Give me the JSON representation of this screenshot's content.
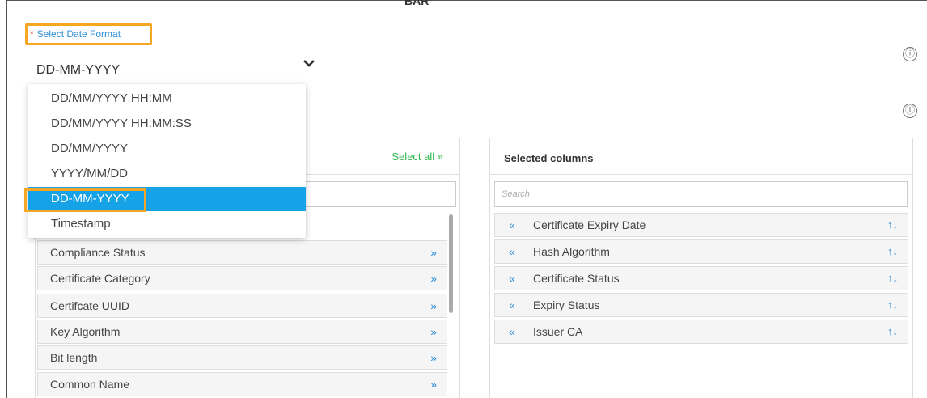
{
  "header": {
    "cut_title": "BAR"
  },
  "date_format": {
    "label": "Select Date Format",
    "required_mark": "*",
    "selected_value": "DD-MM-YYYY",
    "options": [
      "DD/MM/YYYY HH:MM",
      "DD/MM/YYYY HH:MM:SS",
      "DD/MM/YYYY",
      "YYYY/MM/DD",
      "DD-MM-YYYY",
      "Timestamp"
    ],
    "highlighted_option": "DD-MM-YYYY"
  },
  "icons": {
    "info": "ⓘ",
    "chevron": "chevron-down-icon",
    "move_right": "»",
    "move_left": "«",
    "sort": "↑↓"
  },
  "available_columns": {
    "select_all_label": "Select all »",
    "rows": [
      "Compliance Status",
      "Certificate Category",
      "Certifcate UUID",
      "Key Algorithm",
      "Bit length",
      "Common Name"
    ]
  },
  "selected_columns": {
    "title": "Selected columns",
    "search_placeholder": "Search",
    "rows": [
      "Certificate Expiry Date",
      "Hash Algorithm",
      "Certificate Status",
      "Expiry Status",
      "Issuer CA"
    ]
  },
  "colors": {
    "accent_blue": "#16a2e6",
    "highlight_orange": "#f5a623",
    "green": "#2db84d",
    "required_red": "#e2231a"
  }
}
